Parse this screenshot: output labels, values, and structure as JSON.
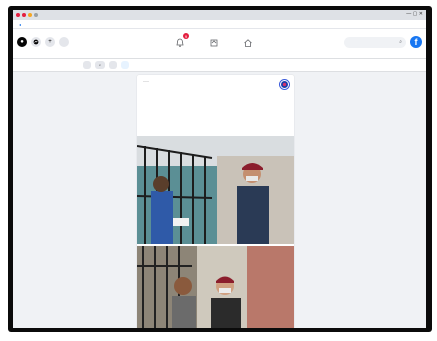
{
  "browser": {
    "tab_title": "",
    "address": "",
    "window_controls": "— ▢ ✕",
    "profile_label": ""
  },
  "nav": {
    "group_label": "",
    "notification_count": "9",
    "search_placeholder": "",
    "logo_letter": "f"
  },
  "pagebar": {
    "buttons": [
      "",
      "",
      ""
    ],
    "links": [
      "",
      "",
      "",
      "",
      ""
    ]
  },
  "post": {
    "page_name": "",
    "meta": "",
    "title": "",
    "body": "",
    "link_text": ""
  },
  "colors": {
    "facebook_blue": "#1877f2",
    "notification_red": "#e41e3f",
    "page_background": "#f0f2f5"
  },
  "icons": {
    "menu": "grid-icon",
    "messenger": "messenger-icon",
    "notifications": "bell-icon",
    "home": "home-icon",
    "search": "search-icon"
  }
}
